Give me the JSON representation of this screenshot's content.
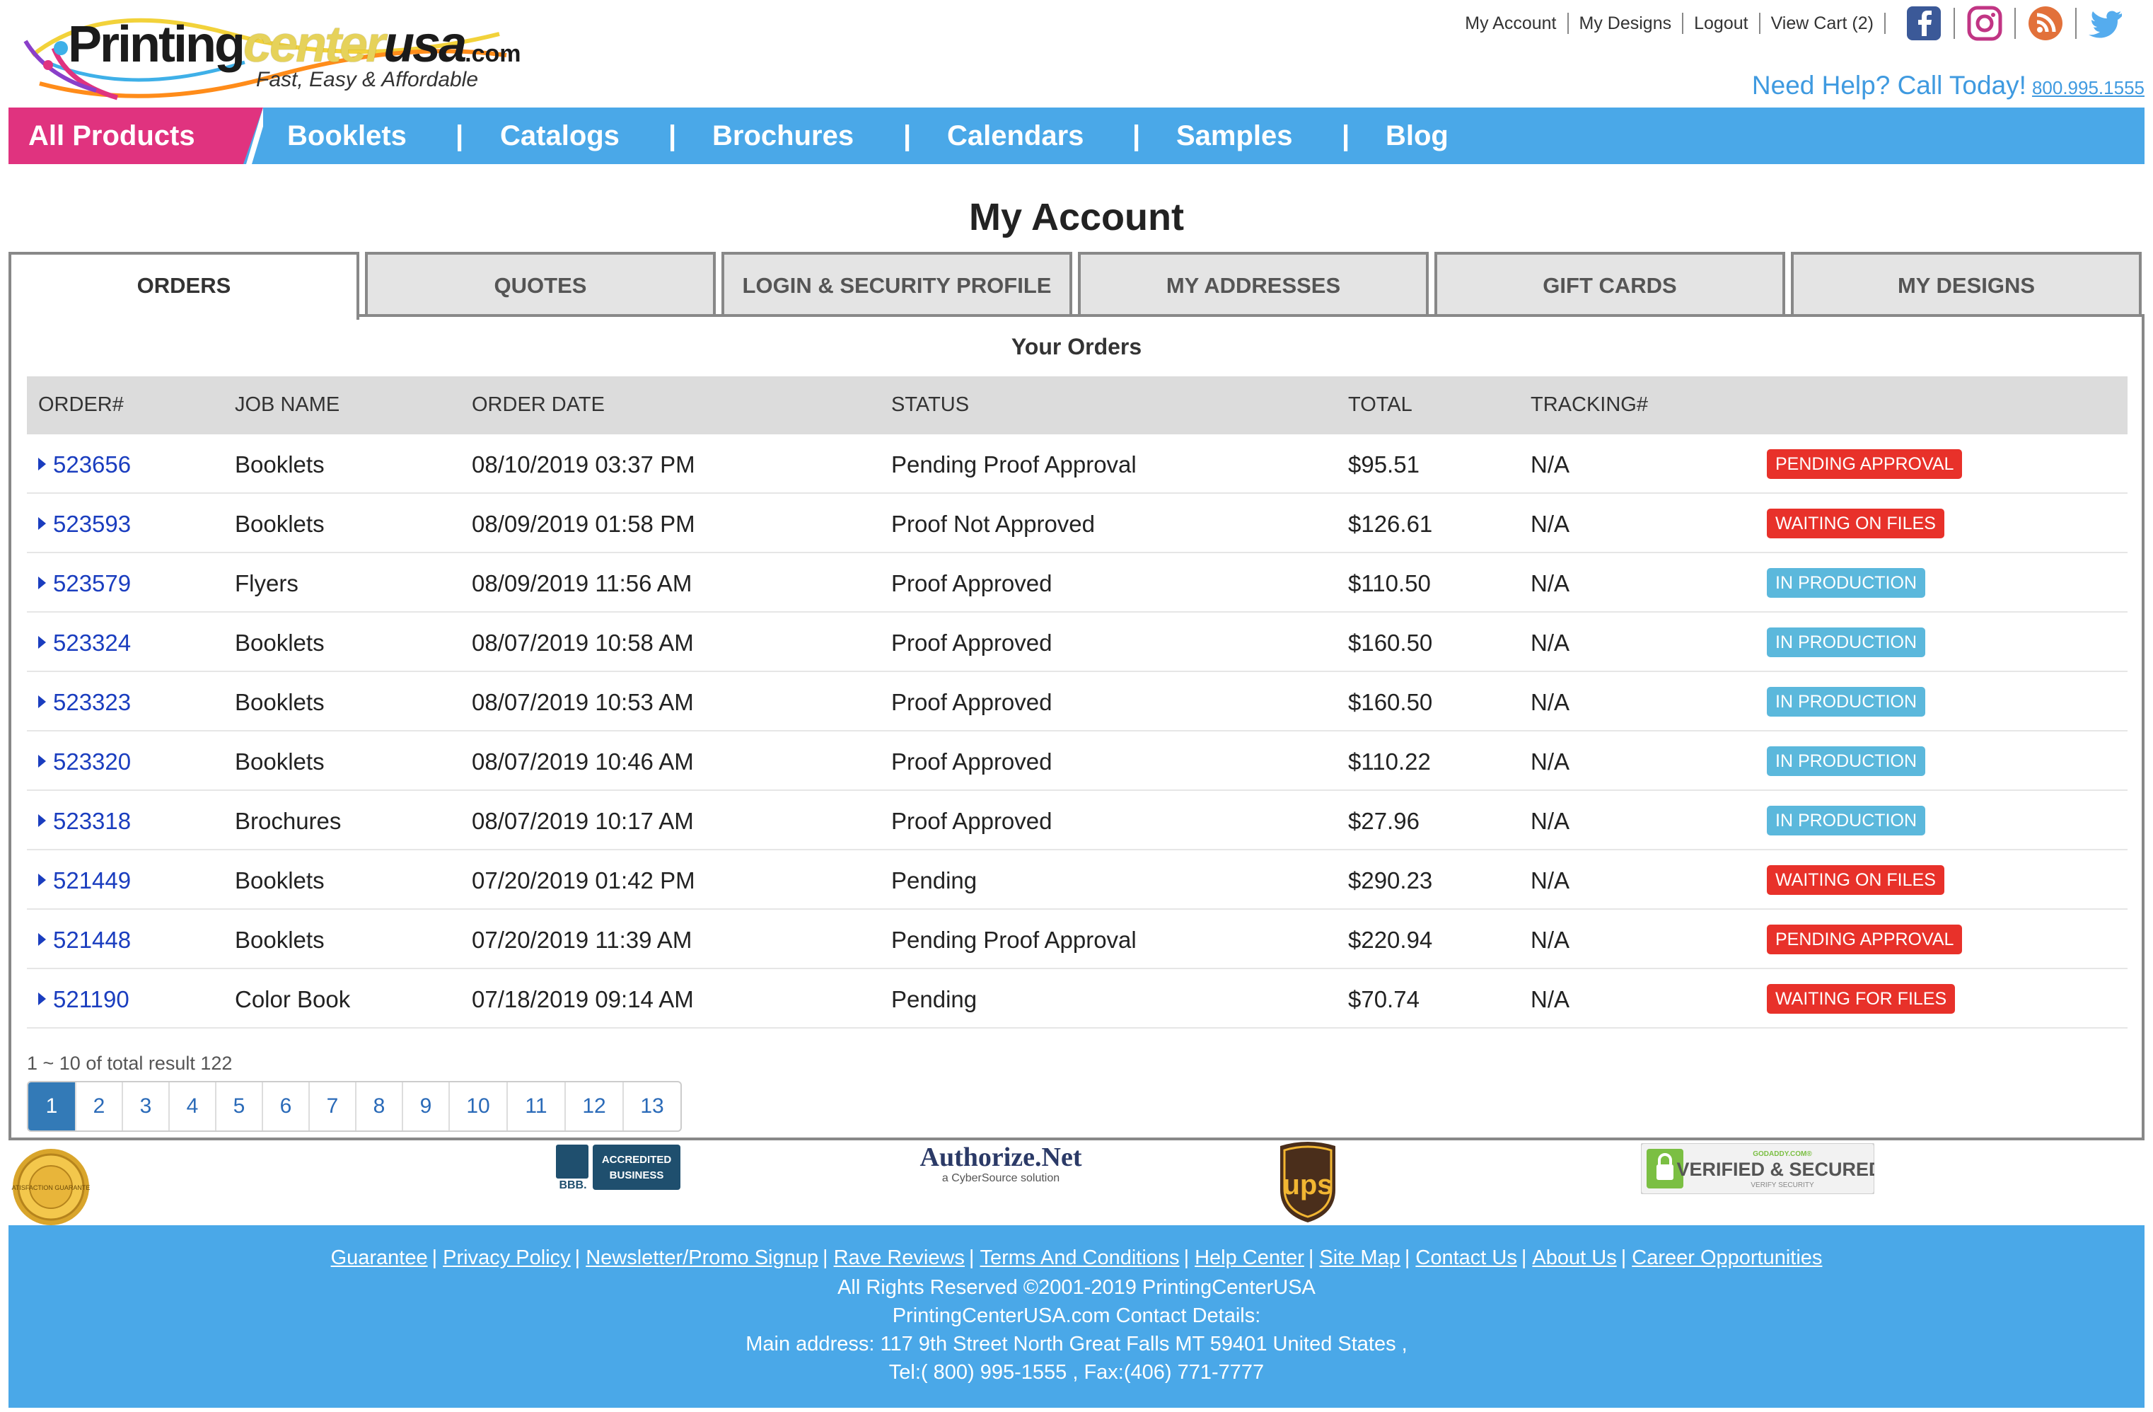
{
  "header": {
    "logo": {
      "brand_main": "Printing",
      "brand_center": "center",
      "brand_usa": "usa",
      "brand_tld": ".com",
      "tagline": "Fast, Easy & Affordable"
    },
    "top_links": [
      "My Account",
      "My Designs",
      "Logout",
      "View Cart (2)"
    ],
    "social_icons": [
      "facebook-icon",
      "instagram-icon",
      "rss-icon",
      "twitter-icon"
    ],
    "help_text": "Need Help? Call Today!",
    "help_phone": "800.995.1555"
  },
  "nav": {
    "all_products": "All Products",
    "items": [
      "Booklets",
      "Catalogs",
      "Brochures",
      "Calendars",
      "Samples",
      "Blog"
    ],
    "separator": "|"
  },
  "page_title": "My Account",
  "tabs": [
    "ORDERS",
    "QUOTES",
    "LOGIN & SECURITY PROFILE",
    "MY ADDRESSES",
    "GIFT CARDS",
    "MY DESIGNS"
  ],
  "active_tab": "ORDERS",
  "orders": {
    "title": "Your Orders",
    "columns": [
      "ORDER#",
      "JOB NAME",
      "ORDER DATE",
      "STATUS",
      "TOTAL",
      "TRACKING#"
    ],
    "rows": [
      {
        "order": "523656",
        "job": "Booklets",
        "date": "08/10/2019 03:37 PM",
        "status": "Pending Proof Approval",
        "total": "$95.51",
        "tracking": "N/A",
        "badge": "PENDING APPROVAL",
        "badge_color": "#e8312a"
      },
      {
        "order": "523593",
        "job": "Booklets",
        "date": "08/09/2019 01:58 PM",
        "status": "Proof Not Approved",
        "total": "$126.61",
        "tracking": "N/A",
        "badge": "WAITING ON FILES",
        "badge_color": "#e8312a"
      },
      {
        "order": "523579",
        "job": "Flyers",
        "date": "08/09/2019 11:56 AM",
        "status": "Proof Approved",
        "total": "$110.50",
        "tracking": "N/A",
        "badge": "IN PRODUCTION",
        "badge_color": "#5bb8dc"
      },
      {
        "order": "523324",
        "job": "Booklets",
        "date": "08/07/2019 10:58 AM",
        "status": "Proof Approved",
        "total": "$160.50",
        "tracking": "N/A",
        "badge": "IN PRODUCTION",
        "badge_color": "#5bb8dc"
      },
      {
        "order": "523323",
        "job": "Booklets",
        "date": "08/07/2019 10:53 AM",
        "status": "Proof Approved",
        "total": "$160.50",
        "tracking": "N/A",
        "badge": "IN PRODUCTION",
        "badge_color": "#5bb8dc"
      },
      {
        "order": "523320",
        "job": "Booklets",
        "date": "08/07/2019 10:46 AM",
        "status": "Proof Approved",
        "total": "$110.22",
        "tracking": "N/A",
        "badge": "IN PRODUCTION",
        "badge_color": "#5bb8dc"
      },
      {
        "order": "523318",
        "job": "Brochures",
        "date": "08/07/2019 10:17 AM",
        "status": "Proof Approved",
        "total": "$27.96",
        "tracking": "N/A",
        "badge": "IN PRODUCTION",
        "badge_color": "#5bb8dc"
      },
      {
        "order": "521449",
        "job": "Booklets",
        "date": "07/20/2019 01:42 PM",
        "status": "Pending",
        "total": "$290.23",
        "tracking": "N/A",
        "badge": "WAITING ON FILES",
        "badge_color": "#e8312a"
      },
      {
        "order": "521448",
        "job": "Booklets",
        "date": "07/20/2019 11:39 AM",
        "status": "Pending Proof Approval",
        "total": "$220.94",
        "tracking": "N/A",
        "badge": "PENDING APPROVAL",
        "badge_color": "#e8312a"
      },
      {
        "order": "521190",
        "job": "Color Book",
        "date": "07/18/2019 09:14 AM",
        "status": "Pending",
        "total": "$70.74",
        "tracking": "N/A",
        "badge": "WAITING FOR FILES",
        "badge_color": "#e8312a"
      }
    ],
    "result_text": "1 ~ 10 of total result 122",
    "pages": [
      "1",
      "2",
      "3",
      "4",
      "5",
      "6",
      "7",
      "8",
      "9",
      "10",
      "11",
      "12",
      "13"
    ],
    "current_page": "1"
  },
  "trust": {
    "guarantee_seal": "SATISFACTION GUARANTEE",
    "bbb_text": "BBB.",
    "bbb_label_1": "ACCREDITED",
    "bbb_label_2": "BUSINESS",
    "authorize_main": "Authorize.Net",
    "authorize_sub": "a CyberSource solution",
    "ups_text": "ups",
    "godaddy_top": "GODADDY.COM®",
    "godaddy_main": "VERIFIED & SECURED",
    "godaddy_sub": "VERIFY SECURITY"
  },
  "footer": {
    "links": [
      "Guarantee",
      "Privacy Policy",
      "Newsletter/Promo Signup",
      "Rave Reviews",
      "Terms And Conditions",
      "Help Center",
      "Site Map",
      "Contact Us",
      "About Us",
      "Career Opportunities"
    ],
    "copyright": "All Rights Reserved ©2001-2019 PrintingCenterUSA",
    "contact_heading": "PrintingCenterUSA.com Contact Details:",
    "address": "Main address: 117 9th Street North Great Falls MT 59401 United States ,",
    "phones": "Tel:( 800) 995-1555 , Fax:(406) 771-7777"
  },
  "colors": {
    "nav_blue": "#4aa8e8",
    "all_products_pink": "#e0337f",
    "badge_red": "#e8312a",
    "badge_blue": "#5bb8dc",
    "link_blue": "#1a3dbf",
    "pager_active": "#337ab7"
  }
}
